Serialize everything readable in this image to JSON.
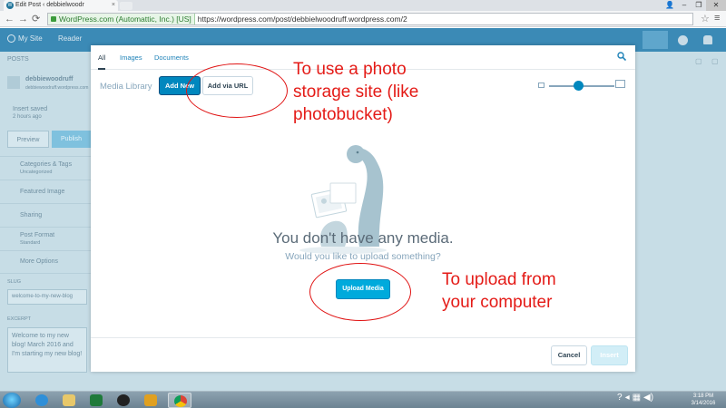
{
  "browser": {
    "tab_title": "Edit Post ‹ debbielwoodr",
    "ssl_label": "WordPress.com (Automattic, Inc.) [US]",
    "url": "https://wordpress.com/post/debbielwoodruff.wordpress.com/2"
  },
  "wp": {
    "my_site": "My Site",
    "reader": "Reader",
    "sidebar": {
      "back": "POSTS",
      "site_name": "debbiewoodruff",
      "site_url": "debbiewoodruff.wordpress.com",
      "draft_label": "Insert saved",
      "draft_sub": "2 hours ago",
      "preview": "Preview",
      "publish": "Publish",
      "categories": "Categories & Tags",
      "categories_sub": "Uncategorized",
      "featured": "Featured Image",
      "sharing": "Sharing",
      "format": "Post Format",
      "format_sub": "Standard",
      "more": "More Options",
      "slug_label": "SLUG",
      "slug_value": "welcome-to-my-new-blog",
      "excerpt_label": "EXCERPT",
      "excerpt_value": "Welcome to my new blog! March 2016 and I'm starting my new blog!"
    }
  },
  "modal": {
    "tabs": [
      "All",
      "Images",
      "Documents"
    ],
    "active_tab": "All",
    "library_label": "Media Library",
    "add_new": "Add New",
    "add_via_url": "Add via URL",
    "zoom_level": 0.45,
    "empty_title": "You don't have any media.",
    "empty_subtitle": "Would you like to upload something?",
    "upload_button": "Upload Media",
    "cancel": "Cancel",
    "insert": "Insert"
  },
  "annotations": {
    "top": [
      "To use a photo",
      "storage site (like",
      "photobucket)"
    ],
    "bottom": [
      "To upload from",
      "your computer"
    ],
    "color": "#e41b17"
  },
  "taskbar": {
    "time": "3:18 PM",
    "date": "3/14/2016"
  },
  "colors": {
    "wp_blue": "#3b8ab6",
    "accent": "#0087be",
    "upload": "#00aadc"
  }
}
